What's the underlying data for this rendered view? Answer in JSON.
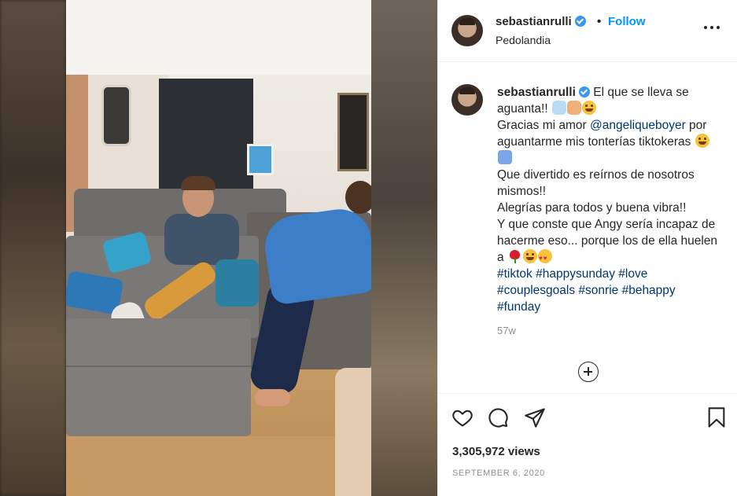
{
  "post": {
    "username": "sebastianrulli",
    "follow_label": "Follow",
    "separator": "•",
    "location": "Pedolandia",
    "more_icon": "more-horizontal-icon"
  },
  "caption": {
    "username": "sebastianrulli",
    "line1": " El que se lleva se aguanta!! ",
    "line2a": "Gracias mi amor ",
    "mention": "@angeliqueboyer",
    "line2b": " por aguantarme mis tonterías tiktokeras ",
    "line3": "Que divertido es reírnos de nosotros mismos!!",
    "line4": "Alegrías para todos y buena vibra!!",
    "line5": "Y que conste que Angy sería incapaz de hacerme eso... porque los de ella huelen a ",
    "hashtags": [
      "#tiktok",
      "#happysunday",
      "#love",
      "#couplesgoals",
      "#sonrie",
      "#behappy",
      "#funday"
    ],
    "time_ago": "57w"
  },
  "actions": {
    "like_icon": "heart-icon",
    "comment_icon": "comment-icon",
    "share_icon": "send-icon",
    "save_icon": "bookmark-icon",
    "load_more_icon": "plus-circle-icon"
  },
  "stats": {
    "views": "3,305,972 views",
    "date": "SEPTEMBER 6, 2020"
  },
  "colors": {
    "link": "#00376b",
    "follow": "#0095f6",
    "verified": "#3897f0",
    "muted": "#8e8e8e"
  }
}
